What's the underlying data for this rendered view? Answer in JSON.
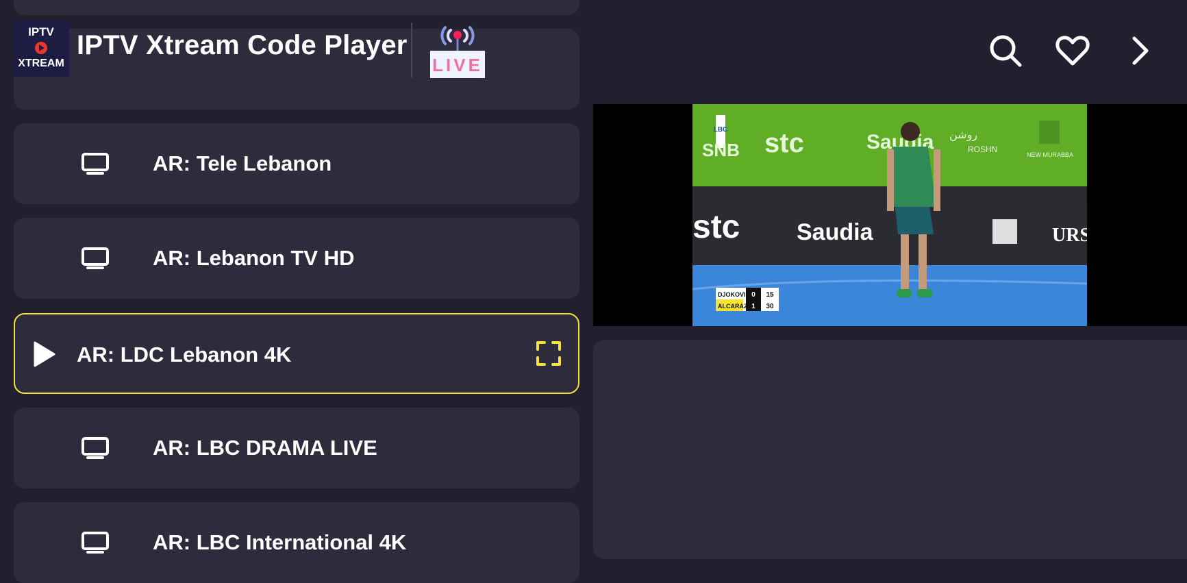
{
  "header": {
    "app_title": "IPTV Xtream Code Player",
    "logo": {
      "line1": "IPTV",
      "line2": "XTREAM"
    },
    "live_badge": "LIVE"
  },
  "toolbar": {
    "icons": [
      "search-icon",
      "heart-icon",
      "chevron-right-icon"
    ]
  },
  "channels": [
    {
      "label": "AR: Tele Lebanon",
      "icon": "tv-icon",
      "selected": false
    },
    {
      "label": "AR: Lebanon TV HD",
      "icon": "tv-icon",
      "selected": false
    },
    {
      "label": "AR: LDC Lebanon 4K",
      "icon": "play-icon",
      "selected": true
    },
    {
      "label": "AR: LBC DRAMA LIVE",
      "icon": "tv-icon",
      "selected": false
    },
    {
      "label": "AR: LBC International 4K",
      "icon": "tv-icon",
      "selected": false
    }
  ],
  "video": {
    "channel_logo": "LBC",
    "sponsors": [
      "SNB",
      "stc",
      "Saudia",
      "روشن",
      "ROSHN",
      "NEW MURABBA",
      "URSU"
    ],
    "scoreboard": [
      {
        "player": "DJOKOVIC",
        "sets": "0",
        "points": "15"
      },
      {
        "player": "ALCARAZ",
        "sets": "1",
        "points": "30"
      }
    ]
  },
  "colors": {
    "background": "#221f2e",
    "card": "#2e2b3d",
    "selection": "#f4e33c",
    "live_pink": "#f26fa3"
  }
}
